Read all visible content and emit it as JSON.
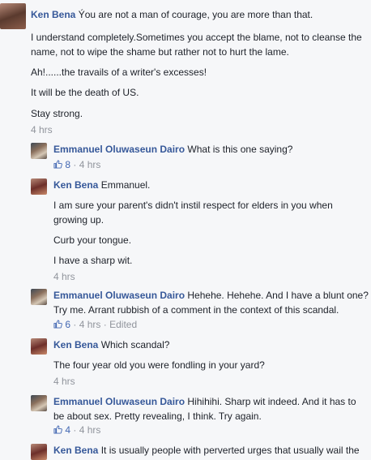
{
  "comments": [
    {
      "author": "Ken Bena",
      "lines": [
        "Ýou are not a man of courage, you are more than that.",
        "I understand completely.Sometimes you accept the blame, not to cleanse the",
        "name, not to wipe the shame but rather not to hurt the lame.",
        "Ah!......the travails of a writer's excesses!",
        "It will be the death of US.",
        "Stay strong."
      ],
      "time": "4 hrs"
    }
  ],
  "replies": [
    {
      "author": "Emmanuel Oluwaseun Dairo",
      "lines": [
        "What is this one saying?"
      ],
      "likes": "8",
      "time": "4 hrs"
    },
    {
      "author": "Ken Bena",
      "lines": [
        "Emmanuel.",
        "I am sure your parent's didn't instil respect for elders in you when",
        "growing up.",
        "Curb your tongue.",
        "I have a sharp wit."
      ],
      "time": "4 hrs"
    },
    {
      "author": "Emmanuel Oluwaseun Dairo",
      "lines": [
        "Hehehe. Hehehe. And I have a blunt one?",
        "Try me. Arrant rubbish of a comment in the context of this scandal."
      ],
      "likes": "6",
      "time": "4 hrs",
      "edited": "Edited"
    },
    {
      "author": "Ken Bena",
      "lines": [
        "Which scandal?",
        "The four year old you were fondling in your yard?"
      ],
      "time": "4 hrs"
    },
    {
      "author": "Emmanuel Oluwaseun Dairo",
      "lines": [
        "Hihihihi. Sharp wit indeed. And it has to",
        "be about sex. Pretty revealing, I think. Try again."
      ],
      "likes": "4",
      "time": "4 hrs"
    },
    {
      "author": "Ken Bena",
      "lines": [
        "It is usually people with perverted urges that usually wail the"
      ]
    }
  ],
  "separator": "·",
  "colors": {
    "link": "#365899",
    "meta": "#90949c",
    "background": "#f6f7f9"
  }
}
